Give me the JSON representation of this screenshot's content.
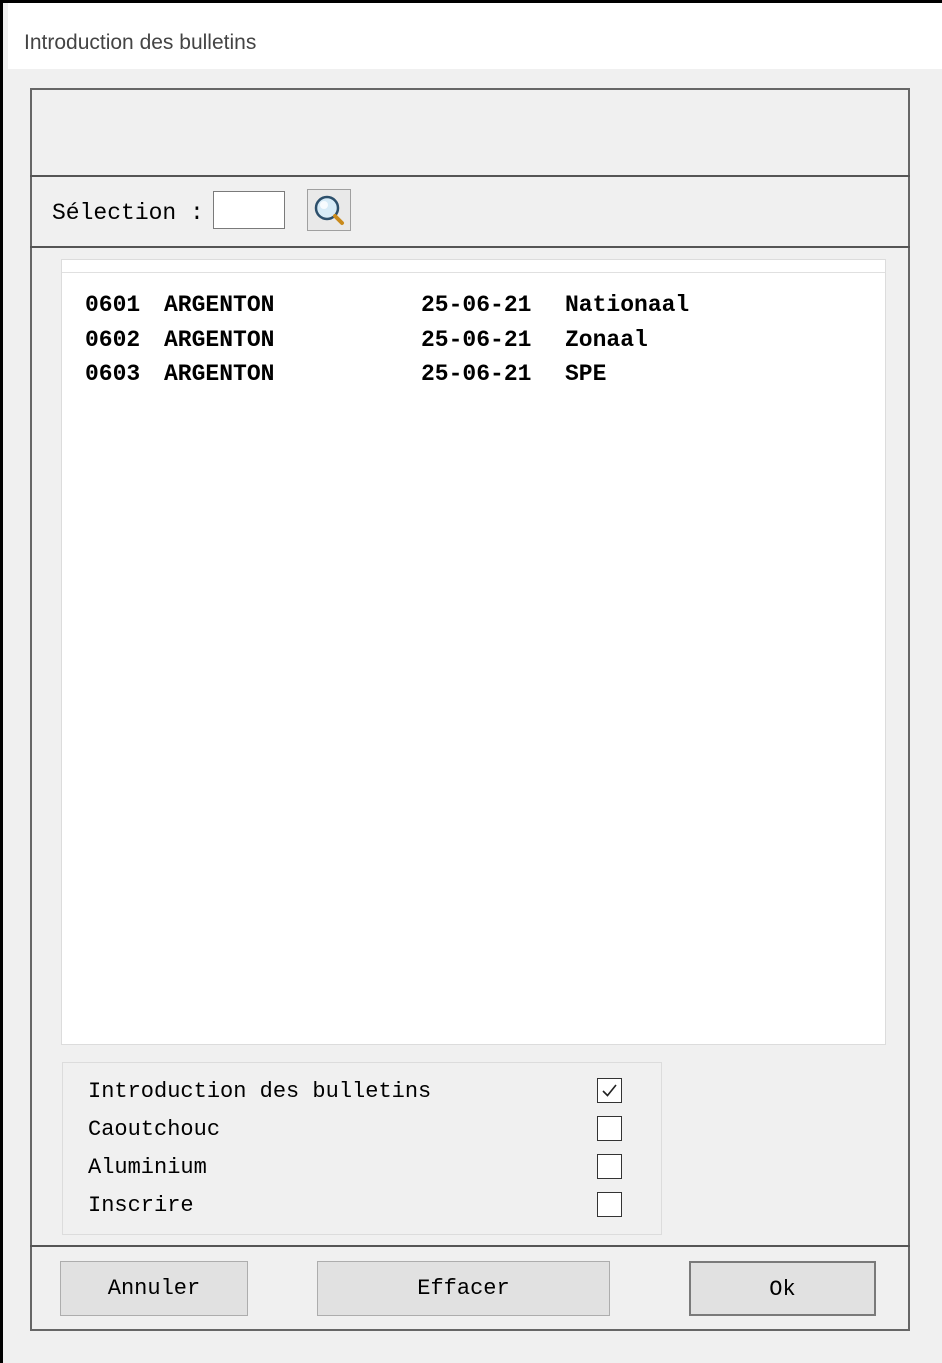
{
  "window": {
    "title": "Introduction des bulletins"
  },
  "selection": {
    "label": "Sélection :",
    "value": "",
    "search_icon": "magnifier-search-icon"
  },
  "list": {
    "items": [
      {
        "code": "0601",
        "name": "ARGENTON",
        "date": "25-06-21",
        "type": "Nationaal"
      },
      {
        "code": "0602",
        "name": "ARGENTON",
        "date": "25-06-21",
        "type": "Zonaal"
      },
      {
        "code": "0603",
        "name": "ARGENTON",
        "date": "25-06-21",
        "type": "SPE"
      }
    ]
  },
  "options": [
    {
      "label": "Introduction des bulletins",
      "checked": true
    },
    {
      "label": "Caoutchouc",
      "checked": false
    },
    {
      "label": "Aluminium",
      "checked": false
    },
    {
      "label": "Inscrire",
      "checked": false
    }
  ],
  "buttons": {
    "cancel": "Annuler",
    "clear": "Effacer",
    "ok": "Ok"
  }
}
